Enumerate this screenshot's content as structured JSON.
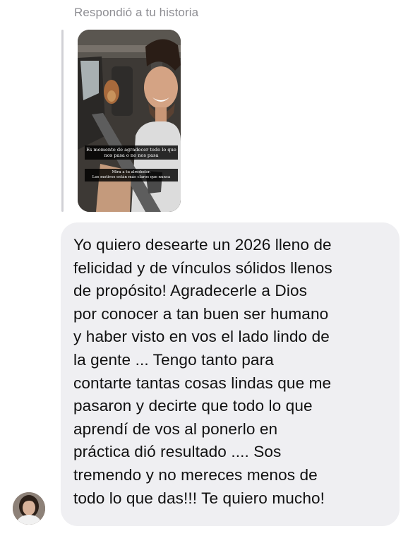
{
  "conversation": {
    "reply_context": "Respondió a tu historia",
    "story": {
      "caption_main": "Es momento de agradecer todo lo que nos pasa o no nos pasa",
      "caption_sub": "Mira a tu alrededor.\nLos motivos están más claros que nunca"
    },
    "message": {
      "text": "Yo quiero desearte un 2026 lleno de\nfelicidad y de vínculos sólidos llenos\nde propósito! Agradecerle a Dios\npor conocer a tan buen ser humano\ny haber visto en vos el lado lindo de\nla gente ... Tengo tanto para\ncontarte tantas cosas lindas que me\npasaron y decirte que todo lo que\naprendí de vos al ponerlo en\npráctica dió resultado .... Sos\ntremendo y no mereces menos de\ntodo lo que das!!! Te quiero mucho!"
    },
    "sender": {
      "avatar_icon": "user-avatar-photo"
    }
  },
  "colors": {
    "bubble_bg": "#efeff2",
    "label_gray": "#8e8e93",
    "quote_bar": "#d1d1d6",
    "text": "#111111"
  }
}
